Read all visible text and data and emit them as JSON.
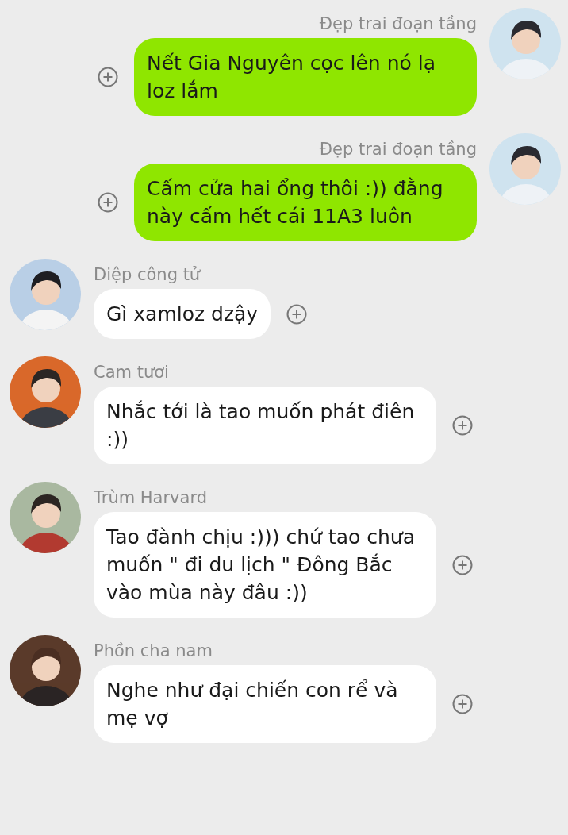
{
  "messages": [
    {
      "kind": "out",
      "sender": "Đẹp trai đoạn tầng",
      "text": "Nết Gia Nguyên cọc lên nó lạ loz lắm"
    },
    {
      "kind": "out",
      "sender": "Đẹp trai đoạn tầng",
      "text": "Cấm cửa hai ổng thôi :)) đằng này cấm hết cái 11A3 luôn"
    },
    {
      "kind": "in",
      "sender": "Diệp công tử",
      "text": "Gì xamloz dzậy"
    },
    {
      "kind": "in",
      "sender": "Cam tươi",
      "text": "Nhắc tới là tao muốn phát điên :))"
    },
    {
      "kind": "in",
      "sender": "Trùm Harvard",
      "text": "Tao đành chịu :))) chứ tao chưa muốn \" đi du lịch \" Đông Bắc vào mùa này đâu :))"
    },
    {
      "kind": "in",
      "sender": "Phồn cha nam",
      "text": "Nghe như đại chiến con rể và mẹ vợ"
    }
  ]
}
